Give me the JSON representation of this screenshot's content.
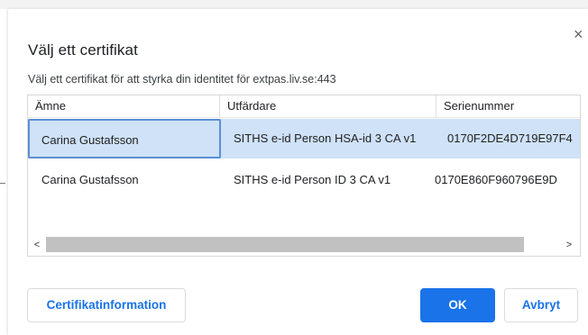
{
  "dialog": {
    "title": "Välj ett certifikat",
    "subtitle": "Välj ett certifikat för att styrka din identitet för extpas.liv.se:443",
    "close_glyph": "×"
  },
  "table": {
    "columns": [
      "Ämne",
      "Utfärdare",
      "Serienummer"
    ],
    "rows": [
      {
        "subject": "Carina Gustafsson",
        "issuer": "SITHS e-id Person HSA-id 3 CA v1",
        "serial": "0170F2DE4D719E97F4",
        "selected": true
      },
      {
        "subject": "Carina Gustafsson",
        "issuer": "SITHS e-id Person ID 3 CA v1",
        "serial": "0170E860F960796E9D"
      }
    ],
    "scroll_left_glyph": "<",
    "scroll_right_glyph": ">"
  },
  "buttons": {
    "info_label": "Certifikatinformation",
    "ok_label": "OK",
    "cancel_label": "Avbryt"
  },
  "colors": {
    "accent": "#1a73e8",
    "selected_row": "#cfe2f7",
    "focus_border": "#5b8fd4"
  }
}
